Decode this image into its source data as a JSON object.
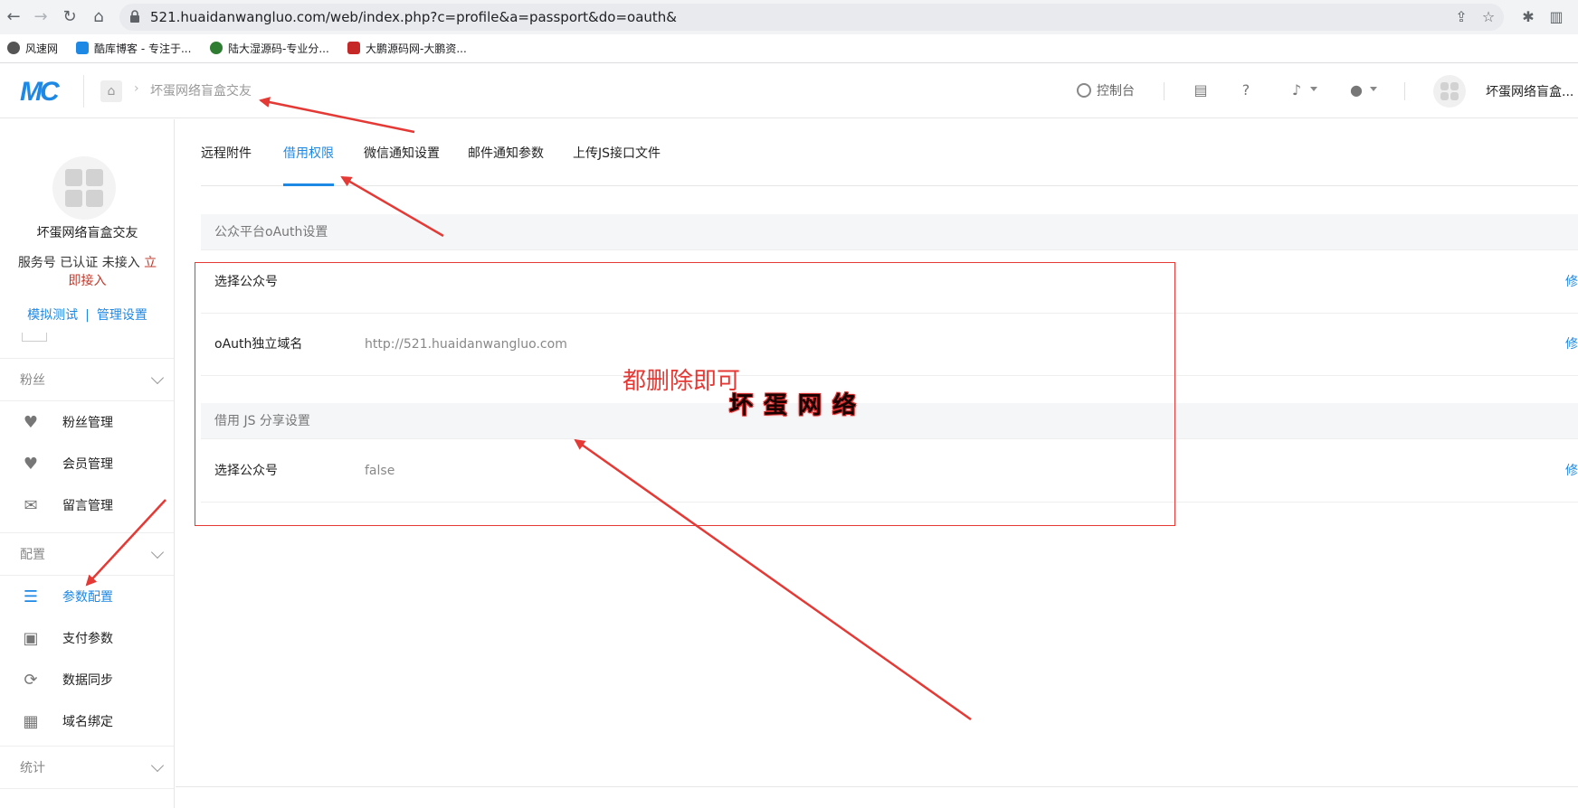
{
  "browser": {
    "url": "521.huaidanwangluo.com/web/index.php?c=profile&a=passport&do=oauth&",
    "bookmarks": [
      {
        "label": "风速网",
        "color": "#555555"
      },
      {
        "label": "酷库博客 - 专注于...",
        "color": "#1e88e5"
      },
      {
        "label": "陆大湿源码-专业分...",
        "color": "#2e7d32"
      },
      {
        "label": "大鹏源码网-大鹏资...",
        "color": "#c62828"
      }
    ]
  },
  "header": {
    "logo": "MC",
    "breadcrumb": "坏蛋网络盲盒交友",
    "console_label": "控制台",
    "account_name": "坏蛋网络盲盒..."
  },
  "sidebar": {
    "account_name": "坏蛋网络盲盒交友",
    "status_prefix": "服务号 已认证 未接入 ",
    "status_link": "立即接入",
    "link_test": "模拟测试",
    "link_sep": "|",
    "link_manage": "管理设置",
    "groups": [
      {
        "title": "粉丝",
        "items": [
          {
            "label": "粉丝管理",
            "icon": "heart-icon"
          },
          {
            "label": "会员管理",
            "icon": "heart-icon"
          },
          {
            "label": "留言管理",
            "icon": "envelope-icon"
          }
        ]
      },
      {
        "title": "配置",
        "items": [
          {
            "label": "参数配置",
            "icon": "list-icon",
            "active": true
          },
          {
            "label": "支付参数",
            "icon": "wallet-icon"
          },
          {
            "label": "数据同步",
            "icon": "sync-icon"
          },
          {
            "label": "域名绑定",
            "icon": "domain-icon"
          }
        ]
      },
      {
        "title": "统计",
        "items": []
      }
    ]
  },
  "tabs": [
    {
      "label": "远程附件"
    },
    {
      "label": "借用权限",
      "active": true
    },
    {
      "label": "微信通知设置"
    },
    {
      "label": "邮件通知参数"
    },
    {
      "label": "上传JS接口文件"
    }
  ],
  "sections": [
    {
      "title": "公众平台oAuth设置",
      "rows": [
        {
          "label": "选择公众号",
          "value": "",
          "action": "修"
        },
        {
          "label": "oAuth独立域名",
          "value": "http://521.huaidanwangluo.com",
          "action": "修"
        }
      ]
    },
    {
      "title": "借用 JS 分享设置",
      "rows": [
        {
          "label": "选择公众号",
          "value": "false",
          "action": "修"
        }
      ]
    }
  ],
  "annotations": {
    "note": "都删除即可",
    "watermark": "坏蛋网络",
    "color": "#e53935"
  },
  "colors": {
    "accent": "#1e88e5",
    "annotation": "#e53935"
  }
}
